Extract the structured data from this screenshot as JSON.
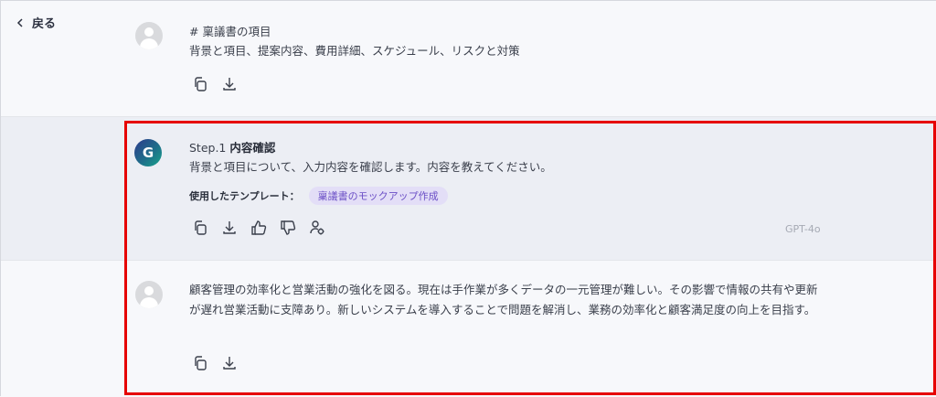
{
  "nav": {
    "back_label": "戻る"
  },
  "messages": {
    "user1": {
      "heading": "# 稟議書の項目",
      "text": "背景と項目、提案内容、費用詳細、スケジュール、リスクと対策"
    },
    "assistant": {
      "avatar_letter": "G",
      "step_prefix": "Step.1",
      "step_title": "内容確認",
      "text": "背景と項目について、入力内容を確認します。内容を教えてください。",
      "template_label": "使用したテンプレート：",
      "template_name": "稟議書のモックアップ作成",
      "model": "GPT-4o"
    },
    "user2": {
      "text": "顧客管理の効率化と営業活動の強化を図る。現在は手作業が多くデータの一元管理が難しい。その影響で情報の共有や更新が遅れ営業活動に支障あり。新しいシステムを導入することで問題を解消し、業務の効率化と顧客満足度の向上を目指す。"
    }
  },
  "icons": {
    "copy": "copy-icon",
    "download": "download-icon",
    "thumbs_up": "thumbs-up-icon",
    "thumbs_down": "thumbs-down-icon",
    "settings_user": "user-settings-icon"
  },
  "colors": {
    "highlight": "#e60000",
    "chip_bg": "#e3def7",
    "chip_text": "#6b4fc6"
  }
}
